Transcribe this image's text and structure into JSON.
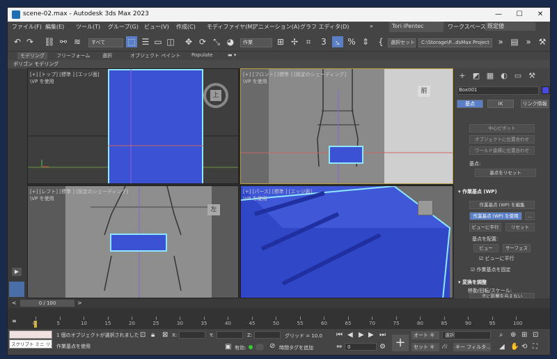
{
  "window": {
    "title": "scene-02.max - Autodesk 3ds Max 2023",
    "controls": {
      "minimize": "—",
      "maximize": "☐",
      "close": "✕"
    }
  },
  "menu": {
    "items": [
      "ファイル(F)",
      "編集(E)",
      "ツール(T)",
      "グループ(G)",
      "ビュー(V)",
      "作成(C)",
      "モディファイヤ(M)",
      "アニメーション(A)",
      "グラフ エディタ(D)"
    ],
    "more": "»",
    "user": "Tori iPentec",
    "workspace_label": "ワークスペース:",
    "workspace_value": "既定値"
  },
  "toolbar": {
    "filter": "すべて",
    "refcoord": "作業",
    "named_selection": "選択セット",
    "project_path": "C:\\Storage\\P...dsMax Project"
  },
  "ribbon": {
    "tabs": [
      "モデリング",
      "フリーフォーム",
      "選択",
      "オブジェクト ペイント",
      "Populate"
    ],
    "sub": "ポリゴン モデリング"
  },
  "viewports": {
    "top": {
      "label": "[+] [トップ] [標準 ] [エッジ面]",
      "vp": "\\VP を使用",
      "cube": "上"
    },
    "front": {
      "label": "[+] [フロント] [標準 ] [既定のシェーディング]",
      "vp": "\\VP を使用",
      "cube": "前"
    },
    "left": {
      "label": "[+] [レフト] [標準 ] [既定のシェーディング]",
      "vp": "\\VP を使用",
      "cube": "左"
    },
    "persp": {
      "label": "[+] [パース] [標準 ] [エッジ面]",
      "vp": "\\VP を使用"
    }
  },
  "command_panel": {
    "object_name": "Box001",
    "tabs": [
      "基点",
      "IK",
      "リンク情報"
    ],
    "disabled_buttons": [
      "中心ピボット",
      "オブジェクトに位置合わせ",
      "ワールド座標に位置合わせ"
    ],
    "pivot_section": "基点:",
    "reset_pivot": "基点をリセット",
    "wp_section": "作業基点 (WP)",
    "wp_edit": "作業基点 (WP) を編集",
    "wp_use": "作業基点 (WP) を使用",
    "wp_more": "...",
    "align_view": "ビューに平行",
    "reset": "リセット",
    "place_pivot": "基点を配置:",
    "view_btn": "ビュー",
    "surface_btn": "サーフェス",
    "align_to_view": "ビューに平行",
    "lock_wp": "作業基点を固定",
    "transform_section": "変換を調整",
    "move_rotate_scale": "移動/回転/スケール:",
    "affect_pivot_only": "子に影響を与えない"
  },
  "timeline": {
    "frame_counter": "0 / 100",
    "ticks": [
      "0",
      "5",
      "10",
      "15",
      "20",
      "25",
      "30",
      "35",
      "40",
      "45",
      "50",
      "55",
      "60",
      "65",
      "70",
      "75",
      "80",
      "85",
      "90",
      "95",
      "100"
    ]
  },
  "status": {
    "script_label": "スクリプト ミニ リス",
    "selected": "1 個のオブジェクトが選択されました",
    "hint": "作業基点を使用",
    "x_label": "X:",
    "y_label": "Y:",
    "z_label": "Z:",
    "grid": "グリッド = 10.0",
    "enabled": "有効:",
    "add_time_tag": "時間タグを追加",
    "frame_value": "0",
    "auto_key": "オート キー",
    "set_key": "セット キー",
    "selection_mode": "選択",
    "key_filters": "キー フィルタ..."
  },
  "colors": {
    "selection": "#3b52d4",
    "selection_edge": "#8fe8ff",
    "accent": "#5a7fc6"
  }
}
